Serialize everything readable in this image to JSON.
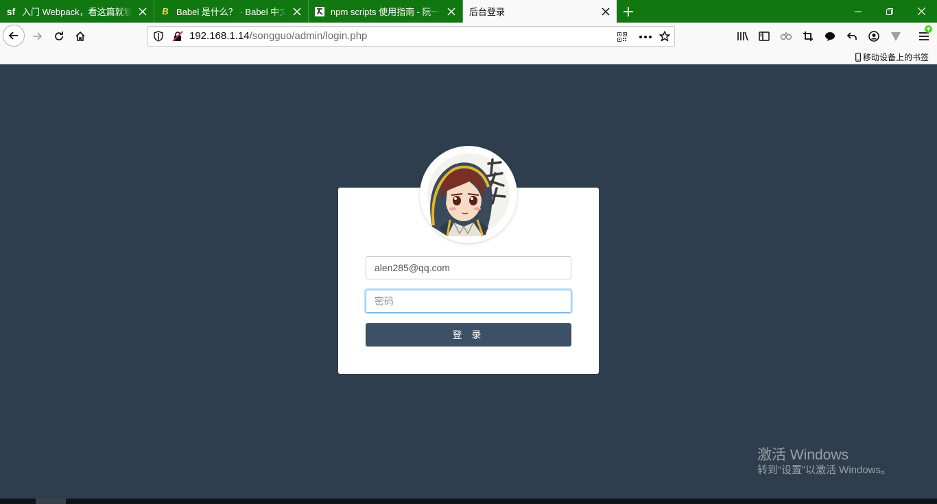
{
  "browser": {
    "tabs": [
      {
        "title": "入门 Webpack，看这篇就够了",
        "icon": "sf-logo-icon",
        "icon_text": "sf",
        "active": false
      },
      {
        "title": "Babel 是什么？ · Babel 中文网",
        "icon": "babel-logo-icon",
        "icon_text": "B",
        "active": false
      },
      {
        "title": "npm scripts 使用指南 - 阮一峰",
        "icon": "ruanyifeng-logo-icon",
        "icon_text": "",
        "active": false
      },
      {
        "title": "后台登录",
        "icon": "",
        "icon_text": "",
        "active": true
      }
    ],
    "new_tab_icon": "plus-icon",
    "url": {
      "host": "192.168.1.14",
      "path": "/songguo/admin/login.php"
    },
    "bookmarks": {
      "mobile_label": "移动设备上的书签"
    }
  },
  "login": {
    "email_value": "alen285@qq.com",
    "password_placeholder": "密码",
    "submit_label": "登 录"
  },
  "watermark": {
    "line1": "激活 Windows",
    "line2": "转到“设置”以激活 Windows。"
  },
  "colors": {
    "tab_strip": "#117811",
    "page_background": "#2f3e4e",
    "button": "#3d5166",
    "focus_border": "#66afe9"
  }
}
